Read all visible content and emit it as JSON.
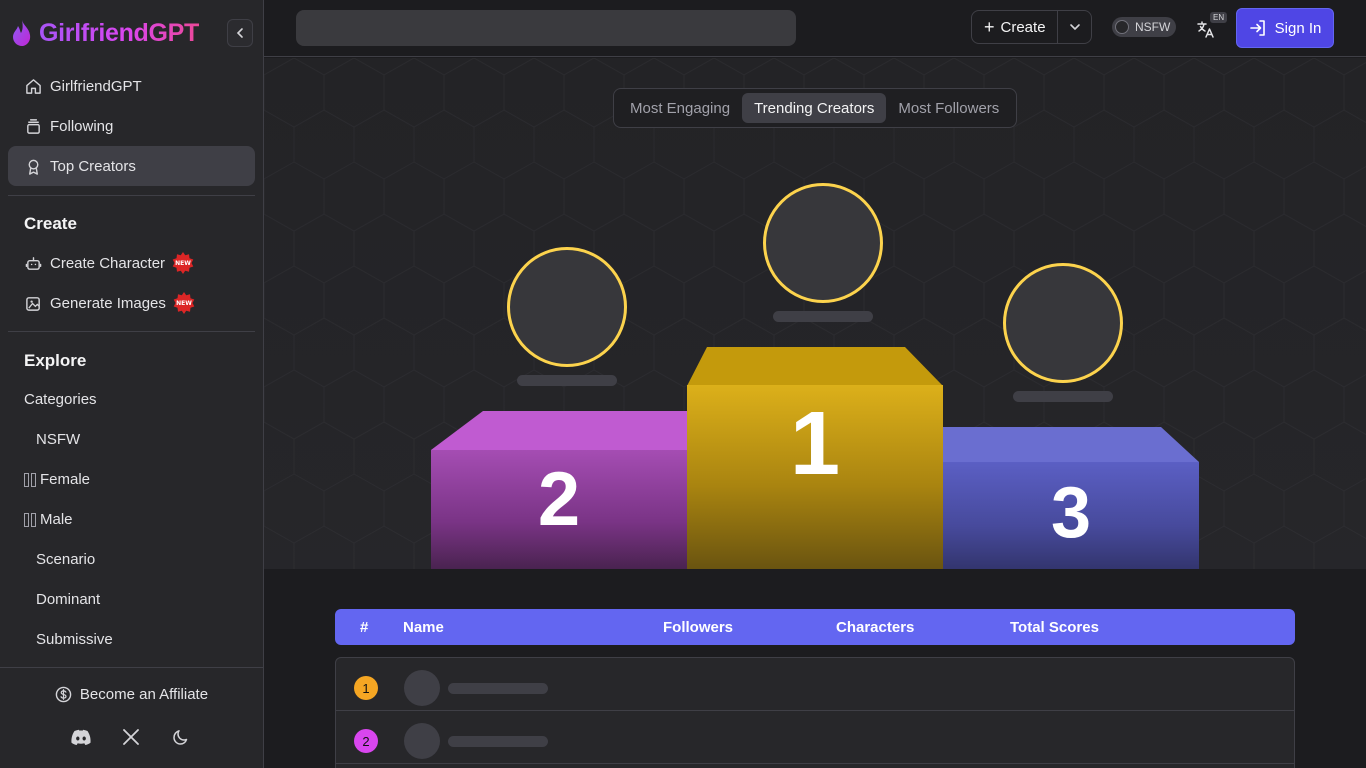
{
  "brand": {
    "name": "GirlfriendGPT"
  },
  "sidebar": {
    "nav": [
      {
        "label": "GirlfriendGPT",
        "icon": "home-icon"
      },
      {
        "label": "Following",
        "icon": "stack-icon"
      },
      {
        "label": "Top Creators",
        "icon": "award-icon",
        "active": true
      }
    ],
    "create": {
      "title": "Create",
      "items": [
        {
          "label": "Create Character",
          "icon": "robot-icon",
          "badge": "NEW"
        },
        {
          "label": "Generate Images",
          "icon": "image-sparkle-icon",
          "badge": "NEW"
        }
      ]
    },
    "explore": {
      "title": "Explore",
      "categories_label": "Categories",
      "categories": [
        "NSFW",
        "Female",
        "Male",
        "Scenario",
        "Dominant",
        "Submissive"
      ]
    },
    "footer": {
      "affiliate": "Become an Affiliate",
      "social": [
        "discord-icon",
        "x-icon",
        "moon-icon"
      ]
    }
  },
  "topbar": {
    "search_placeholder": "",
    "create_label": "Create",
    "nsfw_label": "NSFW",
    "nsfw_enabled": false,
    "lang_badge": "EN",
    "signin_label": "Sign In"
  },
  "tabs": [
    {
      "label": "Most Engaging",
      "active": false
    },
    {
      "label": "Trending Creators",
      "active": true
    },
    {
      "label": "Most Followers",
      "active": false
    }
  ],
  "podium": {
    "first": {
      "rank": "1",
      "color": "#d4a80c"
    },
    "second": {
      "rank": "2",
      "color": "#b44fc2"
    },
    "third": {
      "rank": "3",
      "color": "#5b5fc4"
    },
    "avatar_ring": "#fcd34d"
  },
  "table": {
    "columns": [
      "#",
      "Name",
      "Followers",
      "Characters",
      "Total Scores"
    ],
    "header_color": "#6366f1",
    "rows": [
      {
        "rank": "1",
        "badge_color": "#f5a623"
      },
      {
        "rank": "2",
        "badge_color": "#d946ef"
      }
    ]
  }
}
